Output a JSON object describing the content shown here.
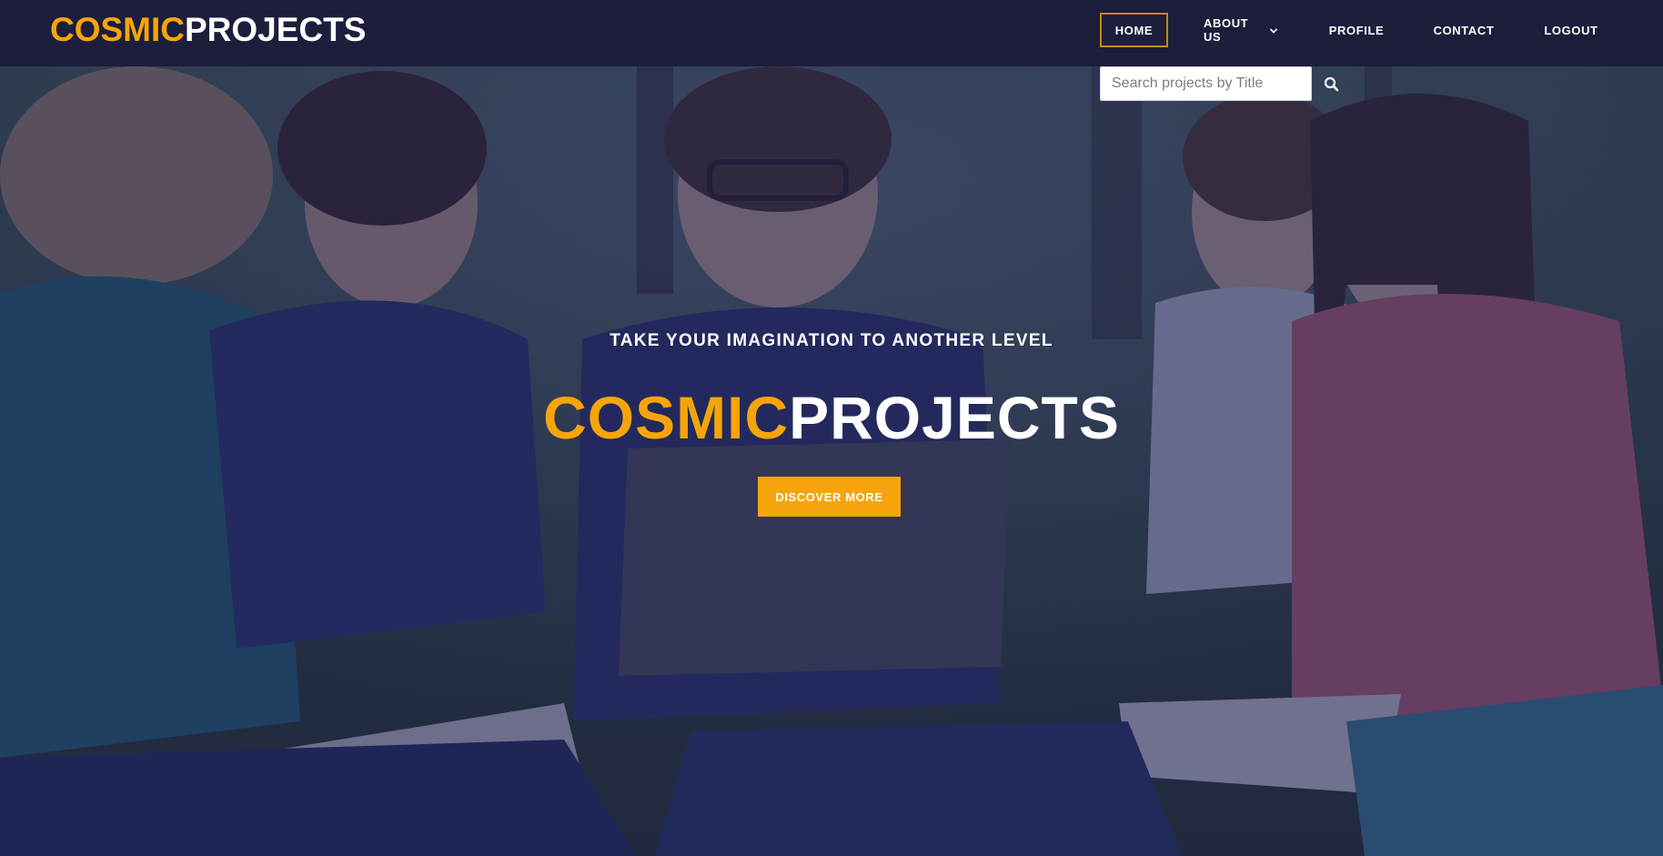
{
  "brand": {
    "accent": "COSMIC",
    "rest": "PROJECTS"
  },
  "nav": {
    "items": [
      {
        "label": "HOME",
        "active": true
      },
      {
        "label": "ABOUT US",
        "dropdown": true
      },
      {
        "label": "PROFILE"
      },
      {
        "label": "CONTACT"
      },
      {
        "label": "LOGOUT"
      }
    ]
  },
  "search": {
    "placeholder": "Search projects by Title",
    "value": "",
    "button_icon": "search-icon"
  },
  "hero": {
    "tagline": "TAKE YOUR IMAGINATION TO ANOTHER LEVEL",
    "title_accent": "COSMIC",
    "title_rest": "PROJECTS",
    "cta_label": "DISCOVER MORE",
    "background": "photo of students sitting on grass with a laptop and books"
  },
  "colors": {
    "navbar_bg": "#1c1e3c",
    "accent": "#f5a50b",
    "active_border": "#c58a10",
    "overlay": "#202352",
    "text": "#ffffff"
  }
}
